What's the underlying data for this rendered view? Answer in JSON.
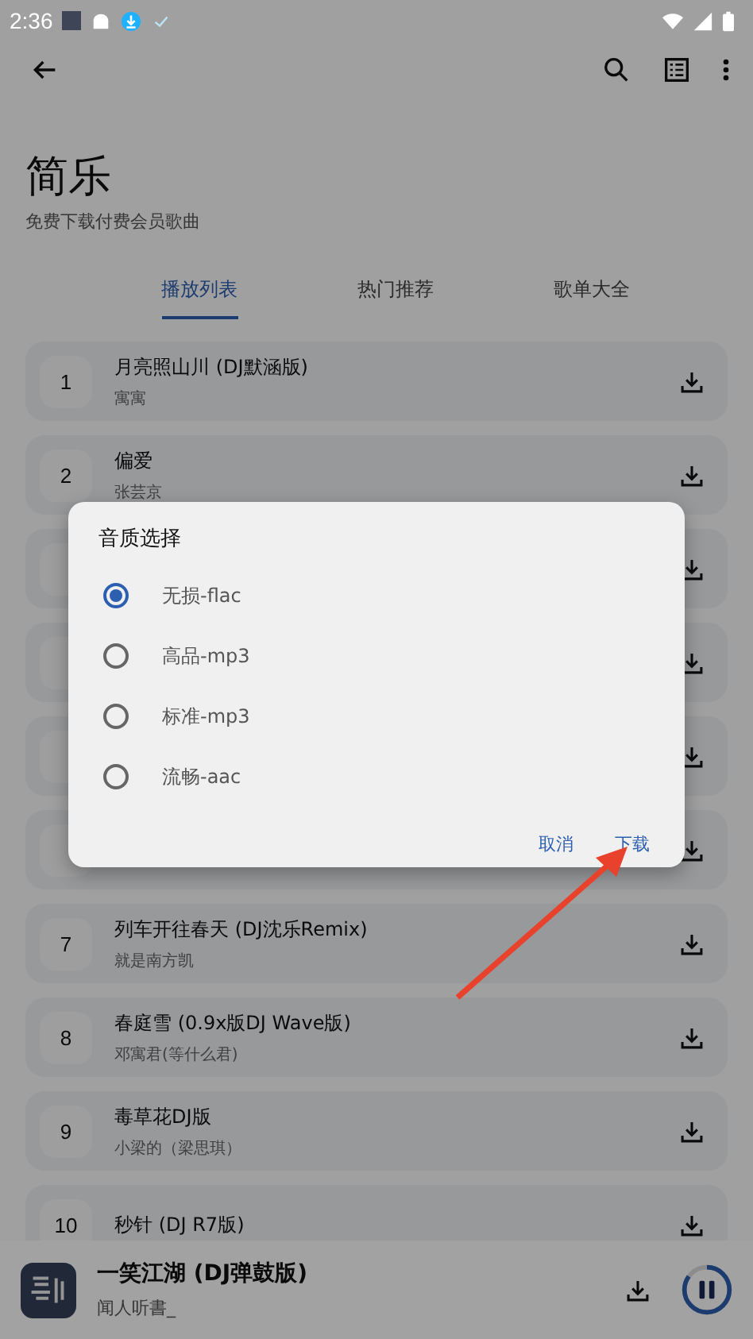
{
  "status_bar": {
    "time": "2:36"
  },
  "app": {
    "title": "简乐",
    "subtitle": "免费下载付费会员歌曲"
  },
  "tabs": [
    {
      "label": "播放列表",
      "selected": true
    },
    {
      "label": "热门推荐",
      "selected": false
    },
    {
      "label": "歌单大全",
      "selected": false
    }
  ],
  "songs": [
    {
      "number": "1",
      "title": "月亮照山川 (DJ默涵版)",
      "artist": "寓寓"
    },
    {
      "number": "2",
      "title": "偏爱",
      "artist": "张芸京"
    },
    {
      "kind": "covered"
    },
    {
      "kind": "covered"
    },
    {
      "kind": "covered"
    },
    {
      "kind": "covered"
    },
    {
      "number": "7",
      "title": "列车开往春天 (DJ沈乐Remix)",
      "artist": "就是南方凯"
    },
    {
      "number": "8",
      "title": "春庭雪 (0.9x版DJ Wave版)",
      "artist": "邓寓君(等什么君)"
    },
    {
      "number": "9",
      "title": "毒草花DJ版",
      "artist": "小梁的（梁思琪）"
    },
    {
      "number": "10",
      "title": "秒针 (DJ R7版)"
    }
  ],
  "player": {
    "title": "一笑江湖 (DJ弹鼓版)",
    "artist": "闻人听書_",
    "level": 0.85
  },
  "dialog": {
    "title": "音质选择",
    "options": [
      {
        "label": "无损-flac",
        "selected": true
      },
      {
        "label": "高品-mp3",
        "selected": false
      },
      {
        "label": "标准-mp3",
        "selected": false
      },
      {
        "label": "流畅-aac",
        "selected": false
      }
    ],
    "buttons": [
      "取消",
      "下载"
    ]
  }
}
